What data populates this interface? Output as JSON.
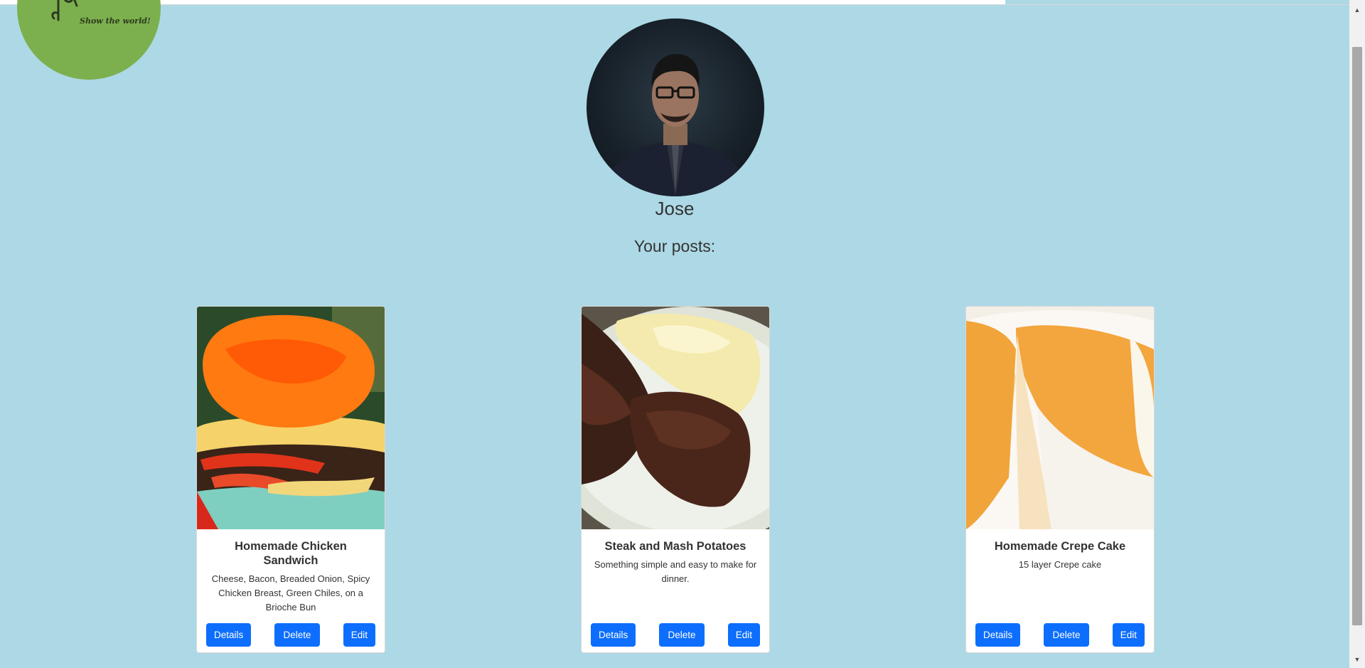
{
  "logo": {
    "tagline": "Show the world!"
  },
  "profile": {
    "username": "Jose",
    "posts_heading": "Your posts:"
  },
  "posts": [
    {
      "title": "Homemade Chicken Sandwich",
      "description": "Cheese, Bacon, Breaded Onion, Spicy Chicken Breast, Green Chiles, on a Brioche Bun",
      "details_label": "Details",
      "delete_label": "Delete",
      "edit_label": "Edit"
    },
    {
      "title": "Steak and Mash Potatoes",
      "description": "Something simple and easy to make for dinner.",
      "details_label": "Details",
      "delete_label": "Delete",
      "edit_label": "Edit"
    },
    {
      "title": "Homemade Crepe Cake",
      "description": "15 layer Crepe cake",
      "details_label": "Details",
      "delete_label": "Delete",
      "edit_label": "Edit"
    }
  ],
  "colors": {
    "background": "#ADD8E6",
    "button": "#0D6EFD",
    "logo_green": "#7CB04E"
  }
}
